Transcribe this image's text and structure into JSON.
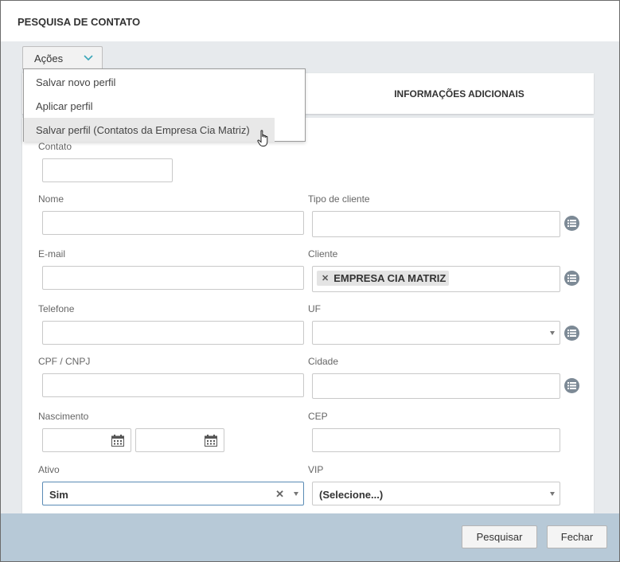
{
  "window": {
    "title": "PESQUISA DE CONTATO"
  },
  "actions": {
    "label": "Ações",
    "menu": [
      {
        "label": "Salvar novo perfil"
      },
      {
        "label": "Aplicar perfil"
      },
      {
        "label": "Salvar perfil (Contatos da Empresa Cia Matriz)"
      }
    ]
  },
  "tabs": {
    "additional": "INFORMAÇÕES ADICIONAIS"
  },
  "form": {
    "contato": {
      "label": "Contato",
      "value": ""
    },
    "nome": {
      "label": "Nome",
      "value": ""
    },
    "tipo_cliente": {
      "label": "Tipo de cliente",
      "value": ""
    },
    "email": {
      "label": "E-mail",
      "value": ""
    },
    "cliente": {
      "label": "Cliente",
      "tag": "EMPRESA CIA MATRIZ"
    },
    "telefone": {
      "label": "Telefone",
      "value": ""
    },
    "uf": {
      "label": "UF",
      "value": ""
    },
    "cpf": {
      "label": "CPF / CNPJ",
      "value": ""
    },
    "cidade": {
      "label": "Cidade",
      "value": ""
    },
    "nascimento": {
      "label": "Nascimento"
    },
    "cep": {
      "label": "CEP",
      "value": ""
    },
    "ativo": {
      "label": "Ativo",
      "value": "Sim"
    },
    "vip": {
      "label": "VIP",
      "value": "(Selecione...)"
    }
  },
  "footer": {
    "search": "Pesquisar",
    "close": "Fechar"
  },
  "colors": {
    "footer_bg": "#b7c9d7",
    "list_button": "#7d8a96",
    "focus_border": "#5a8bb5"
  }
}
